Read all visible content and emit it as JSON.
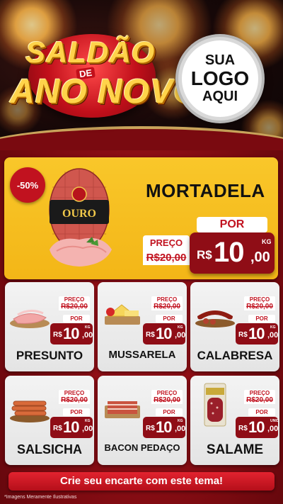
{
  "header": {
    "title_line1": "SALDÃO",
    "title_de": "DE",
    "title_line2": "ANO NOVO",
    "logo": {
      "line1": "SUA",
      "line2": "LOGO",
      "line3": "AQUI"
    }
  },
  "featured": {
    "discount": "-50%",
    "name": "MORTADELA",
    "brand_text": "OURO",
    "preco_label": "PREÇO",
    "old_price": "R$20,00",
    "por_label": "POR",
    "currency": "R$",
    "price_int": "10",
    "price_dec": ",00",
    "unit": "KG"
  },
  "products": [
    {
      "name": "PRESUNTO",
      "preco_label": "PREÇO",
      "old_price": "R$20,00",
      "por_label": "POR",
      "currency": "R$",
      "price_int": "10",
      "price_dec": ",00",
      "unit": "KG"
    },
    {
      "name": "MUSSARELA",
      "preco_label": "PREÇO",
      "old_price": "R$20,00",
      "por_label": "POR",
      "currency": "R$",
      "price_int": "10",
      "price_dec": ",00",
      "unit": "KG"
    },
    {
      "name": "CALABRESA",
      "preco_label": "PREÇO",
      "old_price": "R$20,00",
      "por_label": "POR",
      "currency": "R$",
      "price_int": "10",
      "price_dec": ",00",
      "unit": "KG"
    },
    {
      "name": "SALSICHA",
      "preco_label": "PREÇO",
      "old_price": "R$20,00",
      "por_label": "POR",
      "currency": "R$",
      "price_int": "10",
      "price_dec": ",00",
      "unit": "KG"
    },
    {
      "name": "BACON PEDAÇO",
      "preco_label": "PREÇO",
      "old_price": "R$20,00",
      "por_label": "POR",
      "currency": "R$",
      "price_int": "10",
      "price_dec": ",00",
      "unit": "KG"
    },
    {
      "name": "SALAME",
      "preco_label": "PREÇO",
      "old_price": "R$20,00",
      "por_label": "POR",
      "currency": "R$",
      "price_int": "10",
      "price_dec": ",00",
      "unit": "UNID"
    }
  ],
  "cta": "Crie seu encarte com este tema!",
  "disclaimer": "*Imagens Meramente Ilustrativas",
  "colors": {
    "accent_red": "#c1121f",
    "dark_red": "#8f0d16",
    "gold": "#f3b617",
    "background": "#7a0a10"
  }
}
